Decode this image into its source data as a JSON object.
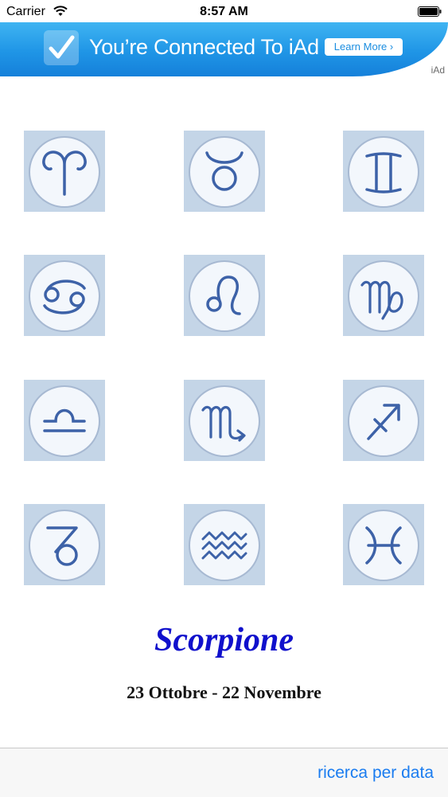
{
  "status_bar": {
    "carrier": "Carrier",
    "time": "8:57 AM"
  },
  "ad": {
    "title": "You’re Connected To iAd",
    "learn_more": "Learn More ›",
    "tag": "iAd"
  },
  "zodiac": {
    "signs": [
      {
        "key": "aries",
        "glyph": "♈"
      },
      {
        "key": "taurus",
        "glyph": "♉"
      },
      {
        "key": "gemini",
        "glyph": "♊"
      },
      {
        "key": "cancer",
        "glyph": "♋"
      },
      {
        "key": "leo",
        "glyph": "♌"
      },
      {
        "key": "virgo",
        "glyph": "♍"
      },
      {
        "key": "libra",
        "glyph": "♎"
      },
      {
        "key": "scorpio",
        "glyph": "♏"
      },
      {
        "key": "sagittarius",
        "glyph": "♐"
      },
      {
        "key": "capricorn",
        "glyph": "♑"
      },
      {
        "key": "aquarius",
        "glyph": "♒"
      },
      {
        "key": "pisces",
        "glyph": "♓"
      }
    ],
    "selected": {
      "name": "Scorpione",
      "dates": "23 Ottobre - 22 Novembre"
    }
  },
  "toolbar": {
    "search_by_date": "ricerca per data"
  },
  "colors": {
    "sign_name": "#1010cc",
    "link": "#1a7cf0",
    "ad_blue": "#1f95e6",
    "glyph_blue": "#3d62a8"
  }
}
